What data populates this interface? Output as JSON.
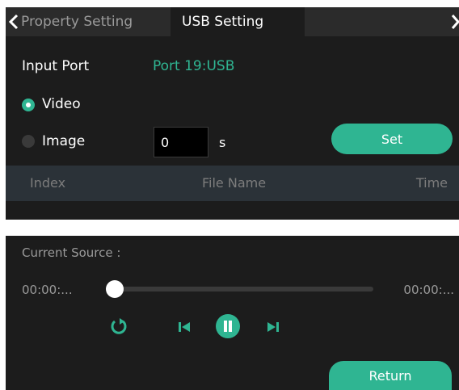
{
  "tabs": {
    "property_setting": "Property Setting",
    "usb_setting": "USB Setting"
  },
  "input_port": {
    "label": "Input Port",
    "value": "Port 19:USB"
  },
  "mode": {
    "video_label": "Video",
    "image_label": "Image",
    "selected": "Video"
  },
  "image_duration": {
    "value": "0",
    "unit": "s"
  },
  "buttons": {
    "set": "Set",
    "return": "Return"
  },
  "file_table": {
    "columns": [
      "Index",
      "File Name",
      "Time"
    ],
    "rows": []
  },
  "player": {
    "current_source_label": "Current Source :",
    "elapsed": "00:00:...",
    "total": "00:00:...",
    "progress": 0
  },
  "colors": {
    "accent": "#2fb592",
    "panel_bg": "#1c1c1c",
    "tab_bar_bg": "#2b2b2b",
    "table_header_bg": "#2b3238"
  },
  "icons": {
    "back": "chevron-left-icon",
    "forward": "chevron-right-icon",
    "loop": "loop-icon",
    "previous": "skip-previous-icon",
    "pause": "pause-icon",
    "next": "skip-next-icon"
  }
}
